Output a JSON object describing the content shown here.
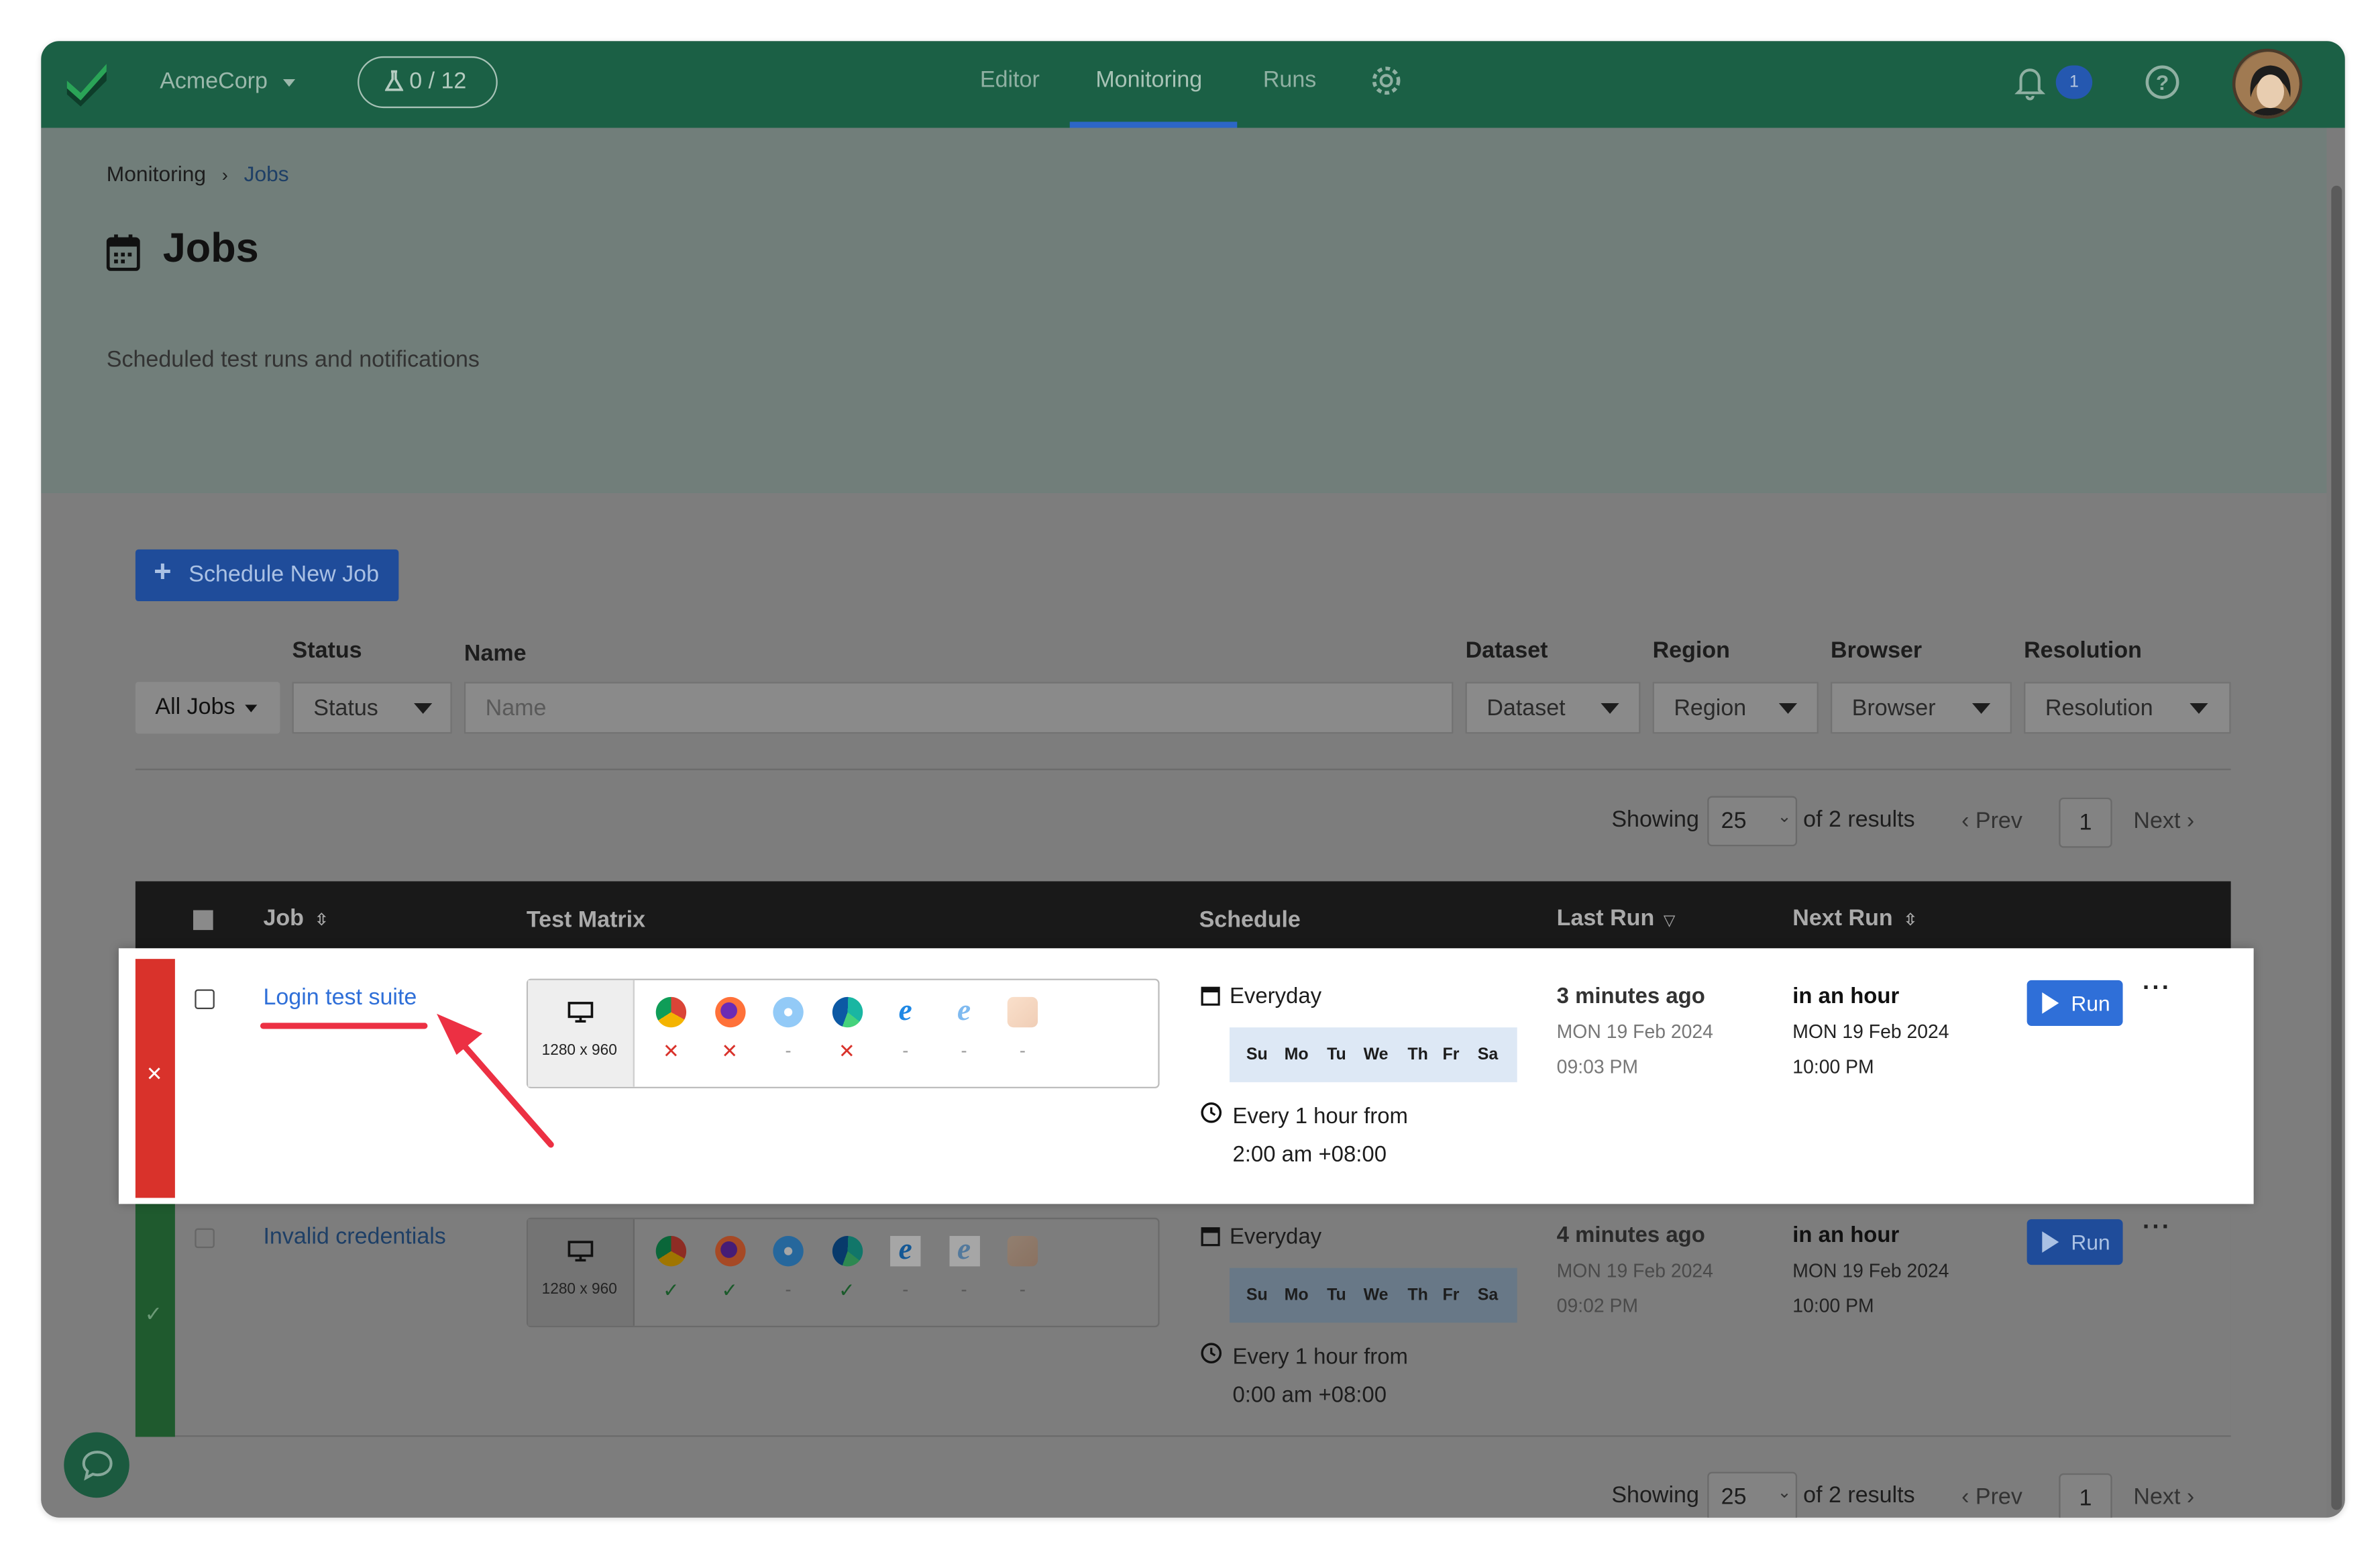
{
  "org": "AcmeCorp",
  "counter": "0 / 12",
  "nav": [
    "Editor",
    "Monitoring",
    "Runs"
  ],
  "notifications": "1",
  "breadcrumb": {
    "parent": "Monitoring",
    "current": "Jobs"
  },
  "page": {
    "title": "Jobs",
    "subtitle": "Scheduled test runs and notifications"
  },
  "schedule_button": "Schedule New Job",
  "filters": {
    "labels": {
      "status": "Status",
      "name": "Name",
      "dataset": "Dataset",
      "region": "Region",
      "browser": "Browser",
      "resolution": "Resolution"
    },
    "all_jobs": "All Jobs",
    "status": "Status",
    "name_placeholder": "Name",
    "dataset": "Dataset",
    "region": "Region",
    "browser": "Browser",
    "resolution": "Resolution"
  },
  "pagination": {
    "showing": "Showing",
    "per_page": "25",
    "of_results": "of 2 results",
    "prev": "Prev",
    "page": "1",
    "next": "Next"
  },
  "columns": {
    "job": "Job",
    "matrix": "Test Matrix",
    "schedule": "Schedule",
    "last_run": "Last Run",
    "next_run": "Next Run"
  },
  "days": [
    "Su",
    "Mo",
    "Tu",
    "We",
    "Th",
    "Fr",
    "Sa"
  ],
  "rows": [
    {
      "name": "Login test suite",
      "status": "failed",
      "resolution": "1280 x 960",
      "results": [
        "✕",
        "✕",
        "-",
        "✕",
        "-",
        "-",
        "-"
      ],
      "frequency": "Everyday",
      "interval": "Every 1 hour from",
      "start": "2:00 am +08:00",
      "last_run": {
        "relative": "3 minutes ago",
        "date": "MON 19 Feb 2024",
        "time": "09:03 PM"
      },
      "next_run": {
        "relative": "in an hour",
        "date": "MON 19 Feb 2024",
        "time": "10:00 PM"
      },
      "run": "Run"
    },
    {
      "name": "Invalid credentials",
      "status": "passed",
      "resolution": "1280 x 960",
      "results": [
        "✓",
        "✓",
        "-",
        "✓",
        "-",
        "-",
        "-"
      ],
      "frequency": "Everyday",
      "interval": "Every 1 hour from",
      "start": "0:00 am +08:00",
      "last_run": {
        "relative": "4 minutes ago",
        "date": "MON 19 Feb 2024",
        "time": "09:02 PM"
      },
      "next_run": {
        "relative": "in an hour",
        "date": "MON 19 Feb 2024",
        "time": "10:00 PM"
      },
      "run": "Run"
    }
  ],
  "browsers": [
    "chrome-icon",
    "firefox-icon",
    "safari-icon",
    "edge-icon",
    "ie-icon",
    "ie-legacy-icon",
    "metamask-icon"
  ],
  "colors": {
    "brand": "#1b6045",
    "fail": "#d9322b",
    "pass": "#1f7a3a",
    "link": "#2f6fd8",
    "annotation": "#ec3043"
  }
}
